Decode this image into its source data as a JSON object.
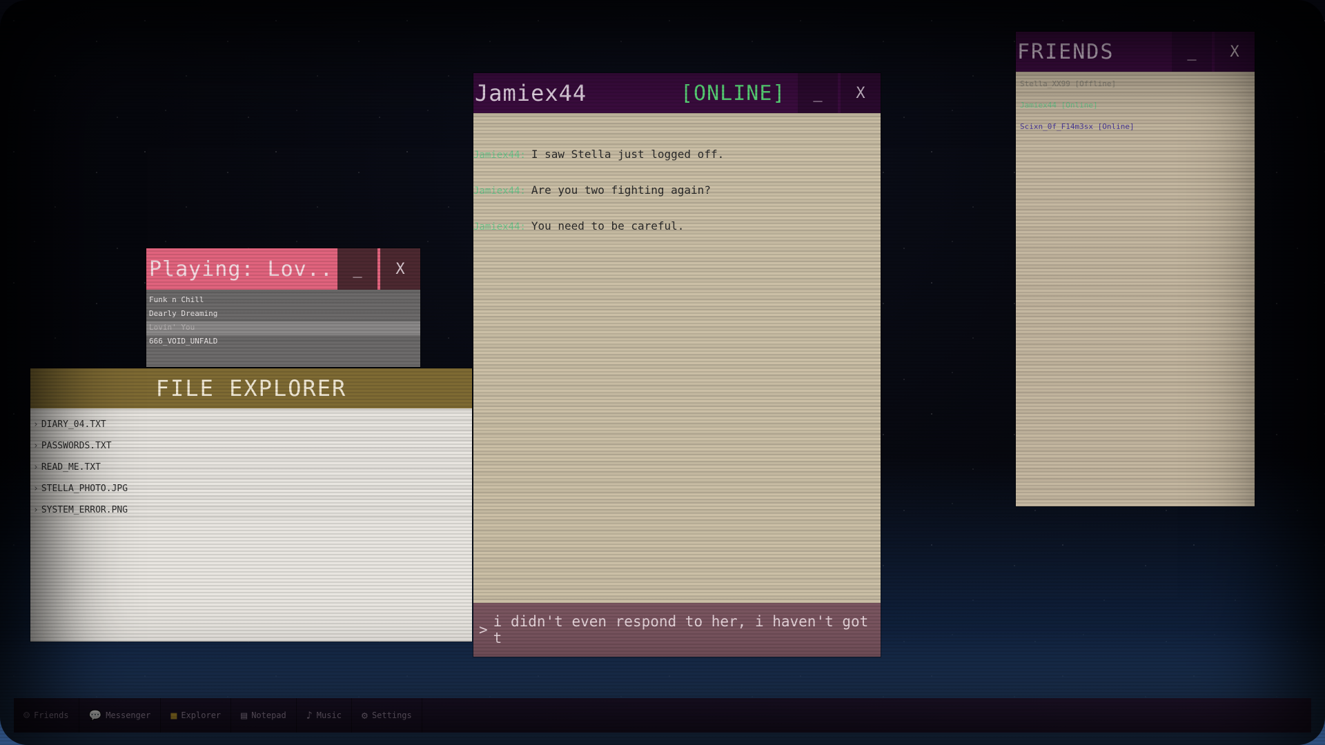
{
  "music": {
    "title": "Playing: Lov...",
    "minimize_label": "_",
    "close_label": "X",
    "tracks": [
      {
        "name": "Funk n Chill"
      },
      {
        "name": "Dearly Dreaming"
      },
      {
        "name": "Lovin' You"
      },
      {
        "name": "666_VOID_UNFALD"
      }
    ]
  },
  "explorer": {
    "title": "FILE EXPLORER",
    "files": [
      {
        "name": "DIARY_04.TXT"
      },
      {
        "name": "PASSWORDS.TXT"
      },
      {
        "name": "READ_ME.TXT"
      },
      {
        "name": "STELLA_PHOTO.JPG"
      },
      {
        "name": "SYSTEM_ERROR.PNG"
      }
    ]
  },
  "chat": {
    "contact": "Jamiex44",
    "status": "[ONLINE]",
    "minimize_label": "_",
    "close_label": "X",
    "messages": [
      {
        "sender": "Jamiex44:",
        "text": "I saw Stella just logged off."
      },
      {
        "sender": "Jamiex44:",
        "text": "Are you two fighting again?"
      },
      {
        "sender": "Jamiex44:",
        "text": "You need to be careful."
      }
    ],
    "input_prompt": ">",
    "input_value": "i didn't even respond to her, i haven't got t"
  },
  "friends": {
    "title": "FRIENDS",
    "minimize_label": "_",
    "close_label": "X",
    "list": [
      {
        "label": "Stella_XX99 [Offline]",
        "color": "#8a8478"
      },
      {
        "label": "Jamiex44 [Online]",
        "color": "#6cc48a"
      },
      {
        "label": "Scixn_0f_F14m3sx [Online]",
        "color": "#4a3a9a"
      }
    ]
  },
  "taskbar": {
    "items": [
      {
        "label": "Friends",
        "icon": "friends-icon"
      },
      {
        "label": "Messenger",
        "icon": "speech-bubble-icon"
      },
      {
        "label": "Explorer",
        "icon": "folder-icon"
      },
      {
        "label": "Notepad",
        "icon": "notepad-icon"
      },
      {
        "label": "Music",
        "icon": "music-icon"
      },
      {
        "label": "Settings",
        "icon": "gear-icon"
      }
    ]
  }
}
